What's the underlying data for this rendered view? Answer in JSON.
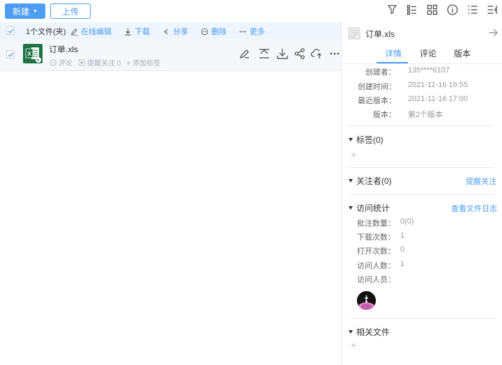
{
  "toolbar": {
    "new_label": "新建",
    "upload_label": "上传"
  },
  "top_icons": [
    "filter-icon",
    "list-view-icon",
    "grid-view-icon",
    "info-icon",
    "sort-icon",
    "collapse-panel-icon"
  ],
  "actionbar": {
    "selection_text": "1个文件(夹)",
    "actions": [
      {
        "label": "在线编辑",
        "icon": "edit-online-icon"
      },
      {
        "label": "下载",
        "icon": "download-icon"
      },
      {
        "label": "分享",
        "icon": "share-icon"
      },
      {
        "label": "删除",
        "icon": "delete-icon"
      },
      {
        "label": "更多",
        "icon": "more-icon"
      }
    ]
  },
  "file": {
    "name": "订单.xls",
    "comment": "评论",
    "remind": "提醒关注 0",
    "add_tag": "+ 添加标签"
  },
  "panel": {
    "title": "订单.xls",
    "tabs": [
      "详情",
      "评论",
      "版本"
    ],
    "details": [
      {
        "key": "创建者：",
        "value": "135****6107"
      },
      {
        "key": "创建时间：",
        "value": "2021-11-16 16:55"
      },
      {
        "key": "最近版本：",
        "value": "2021-11-16 17:00"
      },
      {
        "key": "版本：",
        "value": "第2个版本"
      }
    ],
    "tags": {
      "title": "标签(0)"
    },
    "followers": {
      "title": "关注者(0)",
      "link": "提醒关注"
    },
    "stats": {
      "title": "访问统计",
      "link": "查看文件日志",
      "rows": [
        {
          "key": "批注数量：",
          "value": "0(0)"
        },
        {
          "key": "下载次数：",
          "value": "1"
        },
        {
          "key": "打开次数：",
          "value": "0"
        },
        {
          "key": "访问人数：",
          "value": "1"
        },
        {
          "key": "访问人员：",
          "value": ""
        }
      ]
    },
    "related": {
      "title": "相关文件"
    }
  },
  "colors": {
    "accent": "#4c9df3",
    "selection_bg": "#eef5fd",
    "excel_green": "#1e7145"
  }
}
